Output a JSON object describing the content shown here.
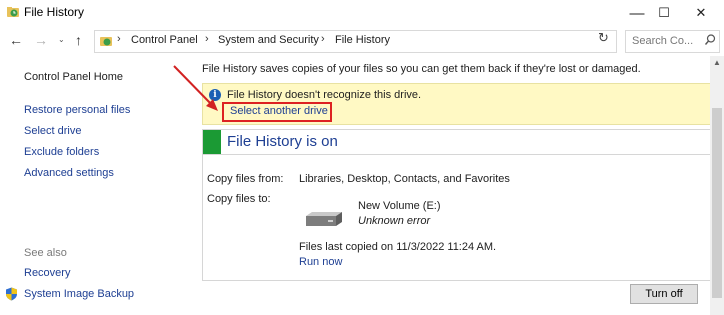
{
  "window": {
    "title": "File History",
    "controls": {
      "minimize": "—",
      "maximize": "☐",
      "close": "✕"
    }
  },
  "address_bar": {
    "crumbs": [
      "Control Panel",
      "System and Security",
      "File History"
    ],
    "search_placeholder": "Search Co..."
  },
  "sidebar": {
    "home": "Control Panel Home",
    "links": [
      "Restore personal files",
      "Select drive",
      "Exclude folders",
      "Advanced settings"
    ],
    "see_also_label": "See also",
    "see_also_links": [
      "Recovery",
      "System Image Backup"
    ]
  },
  "main": {
    "intro": "File History saves copies of your files so you can get them back if they're lost or damaged.",
    "warning": {
      "text": "File History doesn't recognize this drive.",
      "link": "Select another drive"
    },
    "panel": {
      "status": "File History is on",
      "copy_from_label": "Copy files from:",
      "copy_from_value": "Libraries, Desktop, Contacts, and Favorites",
      "copy_to_label": "Copy files to:",
      "drive_name": "New Volume (E:)",
      "drive_error": "Unknown error",
      "last_copied": "Files last copied on 11/3/2022 11:24 AM.",
      "run_now": "Run now"
    },
    "turn_off_button": "Turn off"
  },
  "colors": {
    "link": "#1e3f93",
    "status_green": "#1b9a34",
    "warning_bg": "#fff9c4",
    "annotation_red": "#d22222"
  }
}
